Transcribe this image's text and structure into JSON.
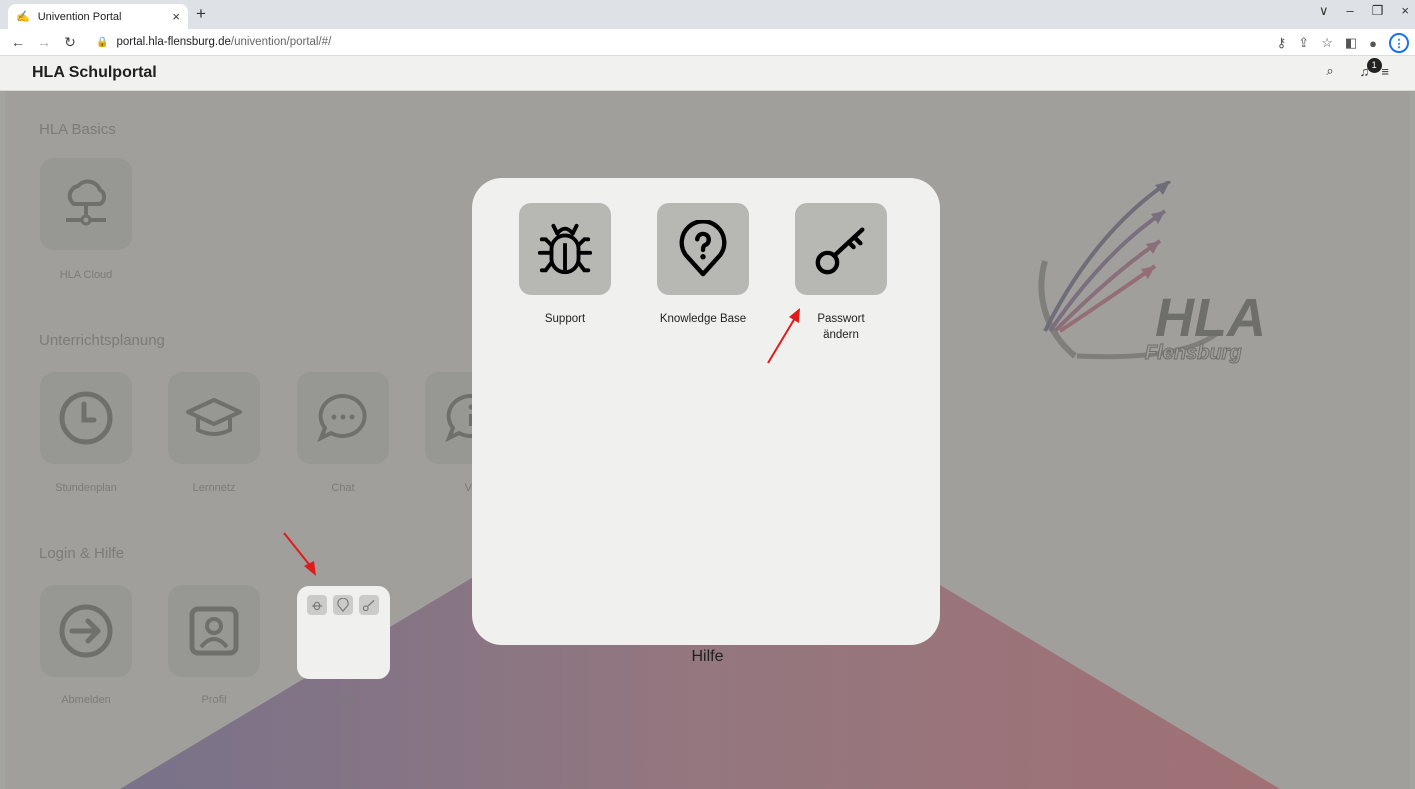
{
  "browser": {
    "tab_title": "Univention Portal",
    "tab_close": "×",
    "new_tab": "+",
    "url_host": "portal.hla-flensburg.de",
    "url_path": "/univention/portal/#/",
    "window_controls": [
      "∨",
      "–",
      "❐",
      "×"
    ]
  },
  "portal": {
    "title": "HLA Schulportal",
    "notification_count": "1"
  },
  "sections": [
    {
      "title": "HLA Basics",
      "tiles": [
        {
          "label": "HLA Cloud",
          "icon": "cloud-network-icon"
        }
      ]
    },
    {
      "title": "Unterrichtsplanung",
      "tiles": [
        {
          "label": "Stundenplan",
          "icon": "clock-icon"
        },
        {
          "label": "Lernnetz",
          "icon": "graduation-cap-icon"
        },
        {
          "label": "Chat",
          "icon": "chat-bubble-icon"
        },
        {
          "label": "Ve",
          "icon": "info-chat-icon"
        }
      ]
    },
    {
      "title": "Login & Hilfe",
      "tiles": [
        {
          "label": "Abmelden",
          "icon": "logout-icon"
        },
        {
          "label": "Profil",
          "icon": "profile-icon"
        },
        {
          "label": "Hilfe",
          "icon": "folder-icon"
        }
      ]
    }
  ],
  "modal": {
    "items": [
      {
        "label": "Support",
        "icon": "bug-icon"
      },
      {
        "label": "Knowledge Base",
        "icon": "question-pin-icon"
      },
      {
        "label_line1": "Passwort",
        "label_line2": "ändern",
        "icon": "key-icon"
      }
    ],
    "caption": "Hilfe"
  },
  "logo": {
    "text_main": "HLA",
    "text_sub": "Flensburg"
  }
}
